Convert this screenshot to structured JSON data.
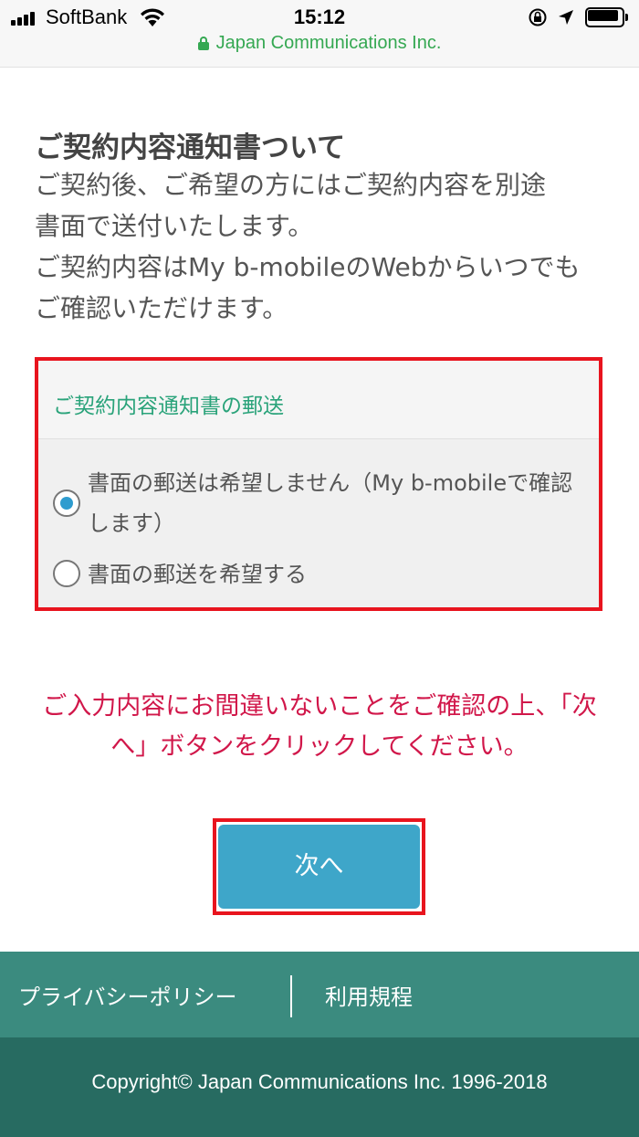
{
  "status_bar": {
    "carrier": "SoftBank",
    "time": "15:12",
    "url": "Japan Communications Inc."
  },
  "section": {
    "title": "ご契約内容通知書ついて",
    "description": [
      "ご契約後、ご希望の方にはご契約内容を別途",
      "書面で送付いたします。",
      "ご契約内容はMy b-mobileのWebからいつでも",
      "ご確認いただけます。"
    ]
  },
  "mail_option": {
    "title": "ご契約内容通知書の郵送",
    "options": [
      {
        "label": "書面の郵送は希望しません（My b-mobileで確認します）",
        "selected": true
      },
      {
        "label": "書面の郵送を希望する",
        "selected": false
      }
    ]
  },
  "notice": "ご入力内容にお間違いないことをご確認の上、「次へ」ボタンをクリックしてください。",
  "next_button": "次へ",
  "footer": {
    "links": [
      "プライバシーポリシー",
      "利用規程"
    ],
    "copyright": "Copyright© Japan Communications Inc. 1996-2018"
  },
  "colors": {
    "accent_green": "#2aa37a",
    "button_blue": "#3ea6c9",
    "notice_red": "#d1174a",
    "highlight_red": "#e8141e",
    "footer_nav": "#3b8b7f",
    "footer_copy": "#276b61"
  }
}
